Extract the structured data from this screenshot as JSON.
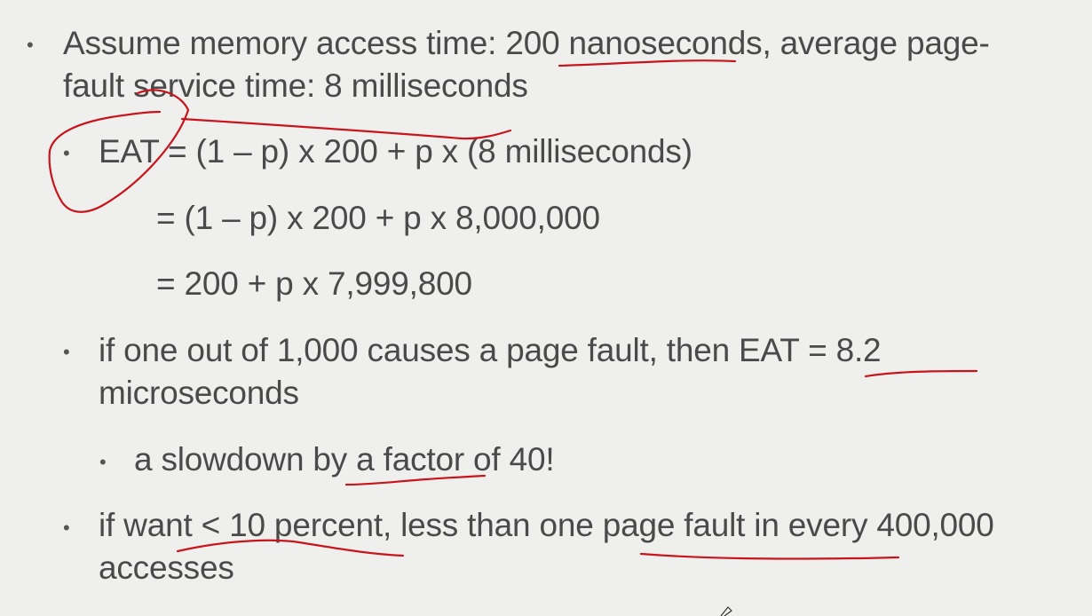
{
  "slide": {
    "b1_line1": "Assume memory access time: 200 nanoseconds, average page-",
    "b1_line2": "fault service time: 8 milliseconds",
    "b2_line1": "EAT  = (1 – p) x 200 + p x (8 milliseconds)",
    "eq_line2": "= (1 – p)  x 200 + p x 8,000,000",
    "eq_line3": "= 200 + p x 7,999,800",
    "b3_line1": "if one out of 1,000 causes a page fault, then EAT = 8.2",
    "b3_line2": "microseconds",
    "b4_line1": "a slowdown by a factor of 40!",
    "b5_line1": "if want < 10 percent, less than one page fault in every 400,000",
    "b5_line2": "accesses"
  },
  "bullet_glyph": "•",
  "colors": {
    "background": "#efefee",
    "text": "#4a4a4a",
    "ink": "#c8151b"
  },
  "icons": {
    "pen_cursor": "pen-cursor-icon"
  }
}
